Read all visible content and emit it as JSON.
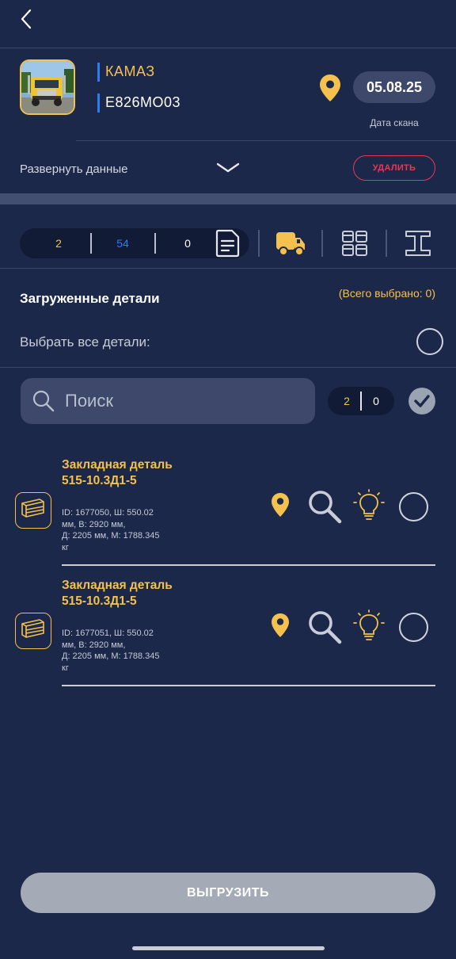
{
  "header": {
    "brand": "КАМАЗ",
    "plate": "Е826МО03",
    "scan_date": "05.08.25",
    "scan_date_caption": "Дата скана",
    "expand_label": "Развернуть данные",
    "delete_label": "УДАЛИТЬ"
  },
  "counters": {
    "first": "2",
    "second": "54",
    "third": "0"
  },
  "section": {
    "title": "Загруженные детали",
    "total_selected": "(Всего выбрано: 0)",
    "select_all": "Выбрать все детали:"
  },
  "search": {
    "placeholder": "Поиск",
    "count_left": "2",
    "count_right": "0"
  },
  "items": [
    {
      "title": "Закладная деталь 515-10.3Д1-5",
      "details": "ID: 1677050, Ш: 550.02 мм, В: 2920 мм,\nД: 2205 мм, М: 1788.345 кг"
    },
    {
      "title": "Закладная деталь 515-10.3Д1-5",
      "details": "ID: 1677051, Ш: 550.02 мм, В: 2920 мм,\nД: 2205 мм, М: 1788.345 кг"
    }
  ],
  "upload_label": "ВЫГРУЗИТЬ",
  "colors": {
    "background": "#1c2849",
    "accent": "#f5c14e",
    "blue": "#2f7bf0",
    "danger": "#e53a55",
    "pill": "#3d486a"
  }
}
